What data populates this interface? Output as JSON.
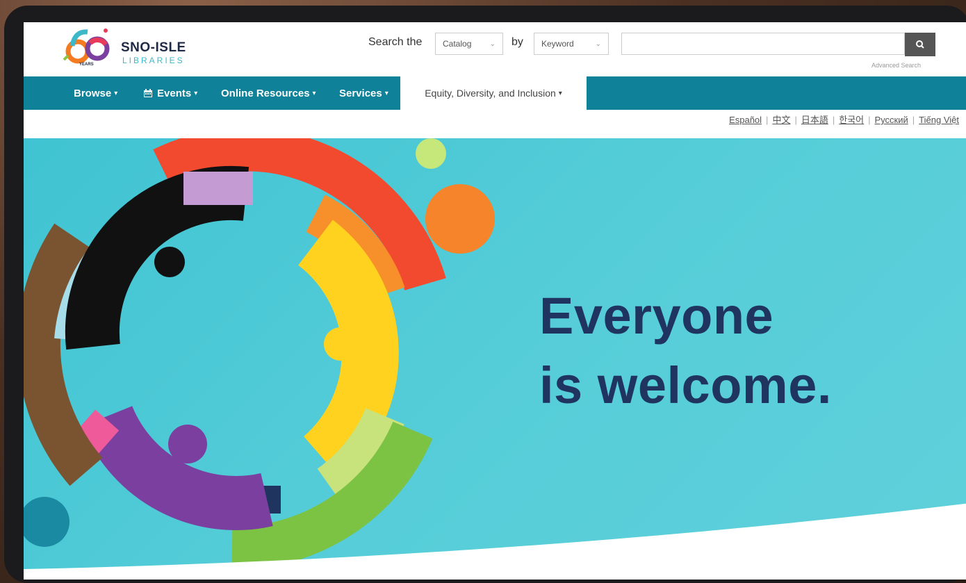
{
  "brand": {
    "name": "SNO-ISLE",
    "sub": "LIBRARIES",
    "anniversary": "60",
    "years_label": "YEARS"
  },
  "search": {
    "label": "Search the",
    "scope_selected": "Catalog",
    "by_label": "by",
    "field_selected": "Keyword",
    "query": "",
    "advanced_label": "Advanced Search"
  },
  "nav": {
    "items": [
      {
        "label": "Browse"
      },
      {
        "label": "Events"
      },
      {
        "label": "Online Resources"
      },
      {
        "label": "Services"
      },
      {
        "label": "Equity, Diversity, and Inclusion"
      }
    ]
  },
  "languages": [
    "Español",
    "中文",
    "日本語",
    "한국어",
    "Русский",
    "Tiếng Việt"
  ],
  "hero": {
    "line1": "Everyone",
    "line2": "is welcome."
  },
  "colors": {
    "nav_bg": "#0f8198",
    "hero_bg": "#4fc9d6",
    "hero_text": "#1f3560"
  }
}
